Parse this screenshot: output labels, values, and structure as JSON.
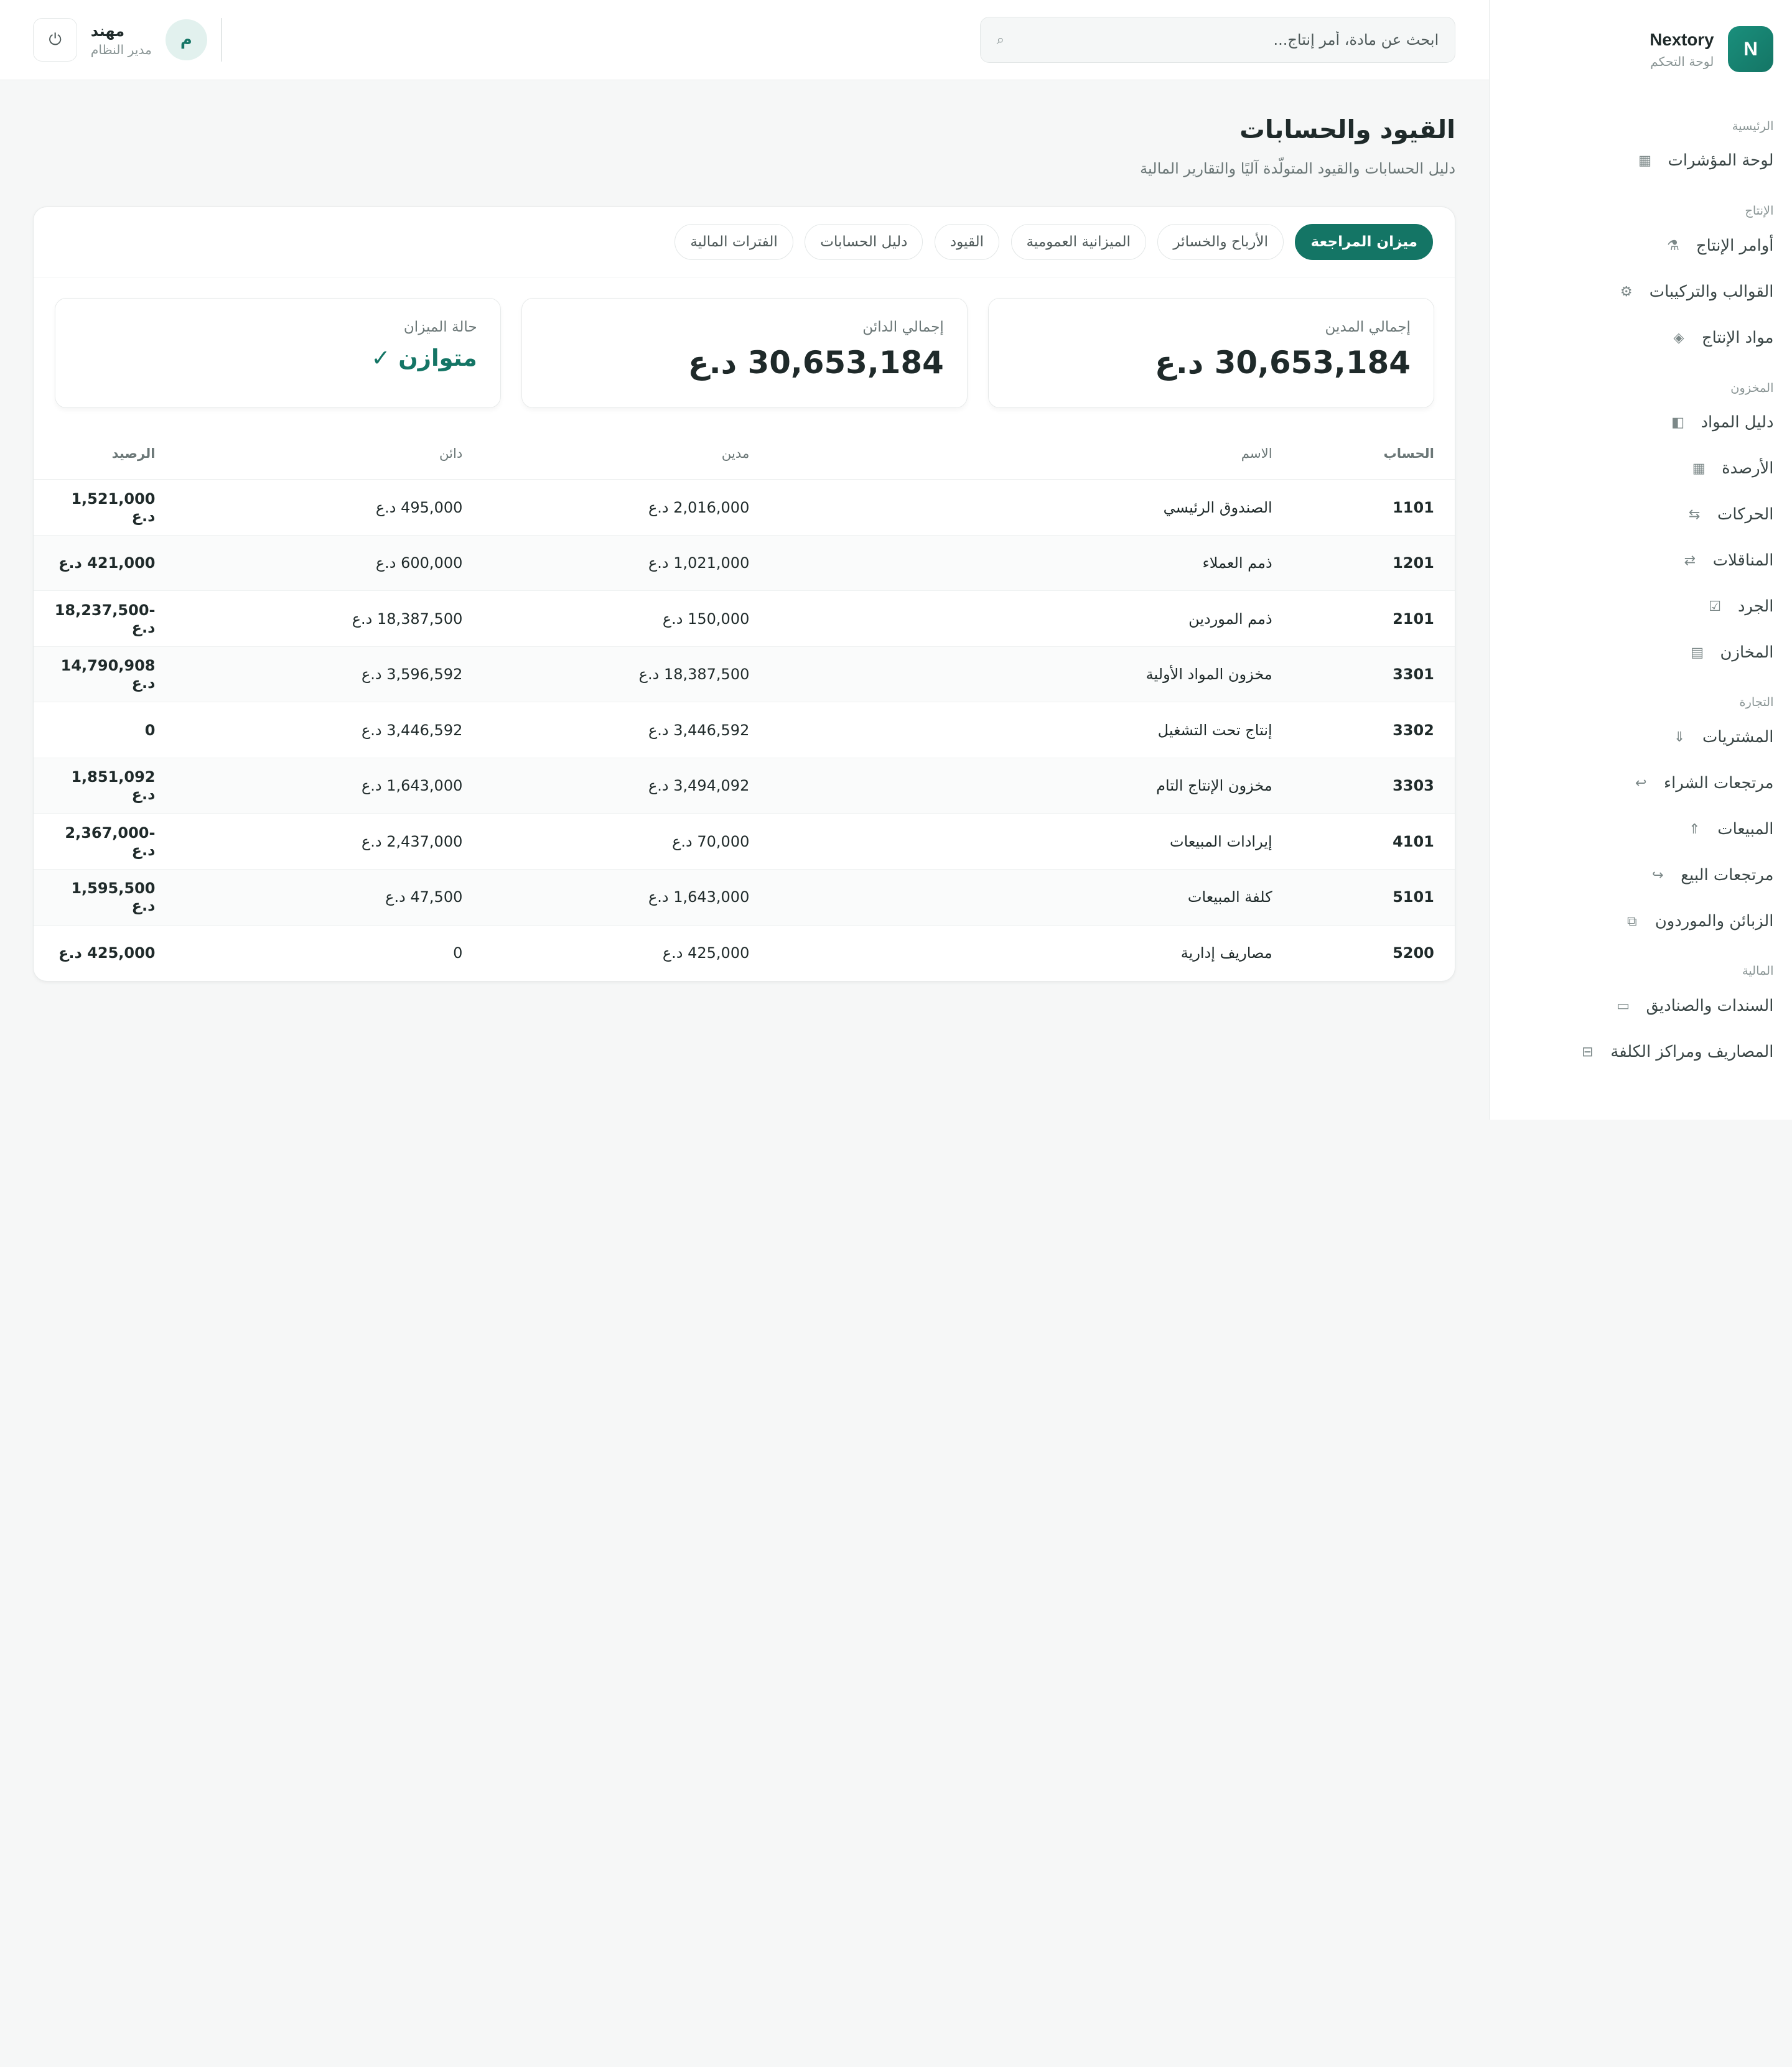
{
  "brand": {
    "logo": "N",
    "name": "Nextory",
    "subtitle": "لوحة التحكم"
  },
  "nav": [
    {
      "title": "الرئيسية",
      "items": [
        {
          "label": "لوحة المؤشرات",
          "icon": "▦"
        }
      ]
    },
    {
      "title": "الإنتاج",
      "items": [
        {
          "label": "أوامر الإنتاج",
          "icon": "⚗"
        },
        {
          "label": "القوالب والتركيبات",
          "icon": "⚙"
        },
        {
          "label": "مواد الإنتاج",
          "icon": "◈"
        }
      ]
    },
    {
      "title": "المخزون",
      "items": [
        {
          "label": "دليل المواد",
          "icon": "◧"
        },
        {
          "label": "الأرصدة",
          "icon": "▦"
        },
        {
          "label": "الحركات",
          "icon": "⇆"
        },
        {
          "label": "المناقلات",
          "icon": "⇄"
        },
        {
          "label": "الجرد",
          "icon": "☑"
        },
        {
          "label": "المخازن",
          "icon": "▤"
        }
      ]
    },
    {
      "title": "التجارة",
      "items": [
        {
          "label": "المشتريات",
          "icon": "⇓"
        },
        {
          "label": "مرتجعات الشراء",
          "icon": "↩"
        },
        {
          "label": "المبيعات",
          "icon": "⇑"
        },
        {
          "label": "مرتجعات البيع",
          "icon": "↪"
        },
        {
          "label": "الزبائن والموردون",
          "icon": "⧉"
        }
      ]
    },
    {
      "title": "المالية",
      "items": [
        {
          "label": "السندات والصناديق",
          "icon": "▭"
        },
        {
          "label": "المصاريف ومراكز الكلفة",
          "icon": "⊟"
        }
      ]
    }
  ],
  "search": {
    "placeholder": "ابحث عن مادة، أمر إنتاج..."
  },
  "user": {
    "avatar": "م",
    "name": "مهند",
    "role": "مدير النظام"
  },
  "page": {
    "title": "القيود والحسابات",
    "subtitle": "دليل الحسابات والقيود المتولّدة آليًا والتقارير المالية"
  },
  "tabs": [
    "ميزان المراجعة",
    "الأرباح والخسائر",
    "الميزانية العمومية",
    "القيود",
    "دليل الحسابات",
    "الفترات المالية"
  ],
  "stats": [
    {
      "label": "إجمالي المدين",
      "value": "30,653,184 د.ع"
    },
    {
      "label": "إجمالي الدائن",
      "value": "30,653,184 د.ع"
    },
    {
      "label": "حالة الميزان",
      "value": "متوازن ✓"
    }
  ],
  "table": {
    "headers": [
      "الحساب",
      "الاسم",
      "مدين",
      "دائن",
      "الرصيد"
    ],
    "rows": [
      [
        "1101",
        "الصندوق الرئيسي",
        "2,016,000 د.ع",
        "495,000 د.ع",
        "1,521,000 د.ع"
      ],
      [
        "1201",
        "ذمم العملاء",
        "1,021,000 د.ع",
        "600,000 د.ع",
        "421,000 د.ع"
      ],
      [
        "2101",
        "ذمم الموردين",
        "150,000 د.ع",
        "18,387,500 د.ع",
        "-18,237,500 د.ع"
      ],
      [
        "3301",
        "مخزون المواد الأولية",
        "18,387,500 د.ع",
        "3,596,592 د.ع",
        "14,790,908 د.ع"
      ],
      [
        "3302",
        "إنتاج تحت التشغيل",
        "3,446,592 د.ع",
        "3,446,592 د.ع",
        "0"
      ],
      [
        "3303",
        "مخزون الإنتاج التام",
        "3,494,092 د.ع",
        "1,643,000 د.ع",
        "1,851,092 د.ع"
      ],
      [
        "4101",
        "إيرادات المبيعات",
        "70,000 د.ع",
        "2,437,000 د.ع",
        "-2,367,000 د.ع"
      ],
      [
        "5101",
        "كلفة المبيعات",
        "1,643,000 د.ع",
        "47,500 د.ع",
        "1,595,500 د.ع"
      ],
      [
        "5200",
        "مصاريف إدارية",
        "425,000 د.ع",
        "0",
        "425,000 د.ع"
      ]
    ]
  }
}
